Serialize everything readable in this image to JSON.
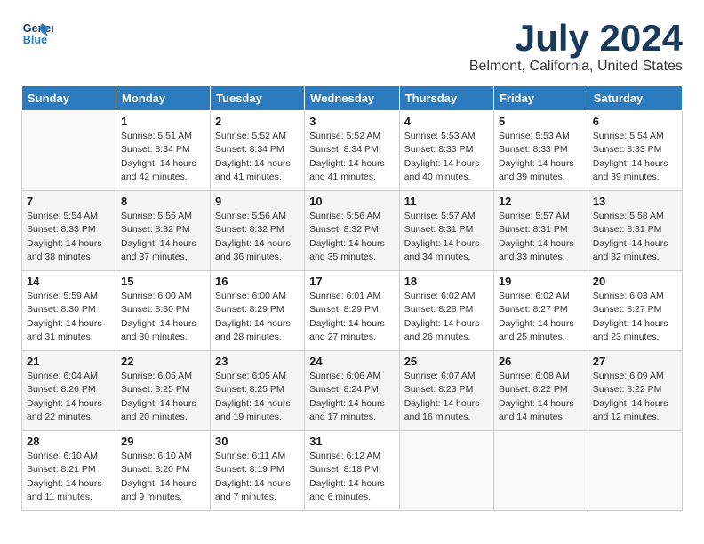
{
  "header": {
    "logo_line1": "General",
    "logo_line2": "Blue",
    "main_title": "July 2024",
    "subtitle": "Belmont, California, United States"
  },
  "weekdays": [
    "Sunday",
    "Monday",
    "Tuesday",
    "Wednesday",
    "Thursday",
    "Friday",
    "Saturday"
  ],
  "weeks": [
    [
      {
        "day": "",
        "info": ""
      },
      {
        "day": "1",
        "info": "Sunrise: 5:51 AM\nSunset: 8:34 PM\nDaylight: 14 hours\nand 42 minutes."
      },
      {
        "day": "2",
        "info": "Sunrise: 5:52 AM\nSunset: 8:34 PM\nDaylight: 14 hours\nand 41 minutes."
      },
      {
        "day": "3",
        "info": "Sunrise: 5:52 AM\nSunset: 8:34 PM\nDaylight: 14 hours\nand 41 minutes."
      },
      {
        "day": "4",
        "info": "Sunrise: 5:53 AM\nSunset: 8:33 PM\nDaylight: 14 hours\nand 40 minutes."
      },
      {
        "day": "5",
        "info": "Sunrise: 5:53 AM\nSunset: 8:33 PM\nDaylight: 14 hours\nand 39 minutes."
      },
      {
        "day": "6",
        "info": "Sunrise: 5:54 AM\nSunset: 8:33 PM\nDaylight: 14 hours\nand 39 minutes."
      }
    ],
    [
      {
        "day": "7",
        "info": "Sunrise: 5:54 AM\nSunset: 8:33 PM\nDaylight: 14 hours\nand 38 minutes."
      },
      {
        "day": "8",
        "info": "Sunrise: 5:55 AM\nSunset: 8:32 PM\nDaylight: 14 hours\nand 37 minutes."
      },
      {
        "day": "9",
        "info": "Sunrise: 5:56 AM\nSunset: 8:32 PM\nDaylight: 14 hours\nand 36 minutes."
      },
      {
        "day": "10",
        "info": "Sunrise: 5:56 AM\nSunset: 8:32 PM\nDaylight: 14 hours\nand 35 minutes."
      },
      {
        "day": "11",
        "info": "Sunrise: 5:57 AM\nSunset: 8:31 PM\nDaylight: 14 hours\nand 34 minutes."
      },
      {
        "day": "12",
        "info": "Sunrise: 5:57 AM\nSunset: 8:31 PM\nDaylight: 14 hours\nand 33 minutes."
      },
      {
        "day": "13",
        "info": "Sunrise: 5:58 AM\nSunset: 8:31 PM\nDaylight: 14 hours\nand 32 minutes."
      }
    ],
    [
      {
        "day": "14",
        "info": "Sunrise: 5:59 AM\nSunset: 8:30 PM\nDaylight: 14 hours\nand 31 minutes."
      },
      {
        "day": "15",
        "info": "Sunrise: 6:00 AM\nSunset: 8:30 PM\nDaylight: 14 hours\nand 30 minutes."
      },
      {
        "day": "16",
        "info": "Sunrise: 6:00 AM\nSunset: 8:29 PM\nDaylight: 14 hours\nand 28 minutes."
      },
      {
        "day": "17",
        "info": "Sunrise: 6:01 AM\nSunset: 8:29 PM\nDaylight: 14 hours\nand 27 minutes."
      },
      {
        "day": "18",
        "info": "Sunrise: 6:02 AM\nSunset: 8:28 PM\nDaylight: 14 hours\nand 26 minutes."
      },
      {
        "day": "19",
        "info": "Sunrise: 6:02 AM\nSunset: 8:27 PM\nDaylight: 14 hours\nand 25 minutes."
      },
      {
        "day": "20",
        "info": "Sunrise: 6:03 AM\nSunset: 8:27 PM\nDaylight: 14 hours\nand 23 minutes."
      }
    ],
    [
      {
        "day": "21",
        "info": "Sunrise: 6:04 AM\nSunset: 8:26 PM\nDaylight: 14 hours\nand 22 minutes."
      },
      {
        "day": "22",
        "info": "Sunrise: 6:05 AM\nSunset: 8:25 PM\nDaylight: 14 hours\nand 20 minutes."
      },
      {
        "day": "23",
        "info": "Sunrise: 6:05 AM\nSunset: 8:25 PM\nDaylight: 14 hours\nand 19 minutes."
      },
      {
        "day": "24",
        "info": "Sunrise: 6:06 AM\nSunset: 8:24 PM\nDaylight: 14 hours\nand 17 minutes."
      },
      {
        "day": "25",
        "info": "Sunrise: 6:07 AM\nSunset: 8:23 PM\nDaylight: 14 hours\nand 16 minutes."
      },
      {
        "day": "26",
        "info": "Sunrise: 6:08 AM\nSunset: 8:22 PM\nDaylight: 14 hours\nand 14 minutes."
      },
      {
        "day": "27",
        "info": "Sunrise: 6:09 AM\nSunset: 8:22 PM\nDaylight: 14 hours\nand 12 minutes."
      }
    ],
    [
      {
        "day": "28",
        "info": "Sunrise: 6:10 AM\nSunset: 8:21 PM\nDaylight: 14 hours\nand 11 minutes."
      },
      {
        "day": "29",
        "info": "Sunrise: 6:10 AM\nSunset: 8:20 PM\nDaylight: 14 hours\nand 9 minutes."
      },
      {
        "day": "30",
        "info": "Sunrise: 6:11 AM\nSunset: 8:19 PM\nDaylight: 14 hours\nand 7 minutes."
      },
      {
        "day": "31",
        "info": "Sunrise: 6:12 AM\nSunset: 8:18 PM\nDaylight: 14 hours\nand 6 minutes."
      },
      {
        "day": "",
        "info": ""
      },
      {
        "day": "",
        "info": ""
      },
      {
        "day": "",
        "info": ""
      }
    ]
  ]
}
